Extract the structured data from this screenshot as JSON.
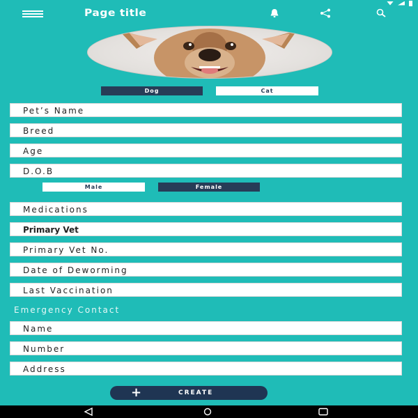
{
  "app_bar": {
    "title": "Page title"
  },
  "pet_type": {
    "options": [
      "Dog",
      "Cat"
    ],
    "selected": "Dog"
  },
  "fields_top": [
    {
      "placeholder": "Pet’s Name"
    },
    {
      "placeholder": "Breed"
    },
    {
      "placeholder": "Age"
    },
    {
      "placeholder": "D.O.B"
    }
  ],
  "gender": {
    "options": [
      "Male",
      "Female"
    ],
    "selected": "Female"
  },
  "fields_mid": [
    {
      "placeholder": "Medications"
    },
    {
      "placeholder": "Primary Vet"
    },
    {
      "placeholder": "Primary Vet No."
    },
    {
      "placeholder": "Date of Deworming"
    },
    {
      "placeholder": "Last Vaccination"
    }
  ],
  "emergency": {
    "section_label": "Emergency Contact",
    "fields": [
      {
        "placeholder": "Name"
      },
      {
        "placeholder": "Number"
      },
      {
        "placeholder": "Address"
      }
    ]
  },
  "create_button": {
    "icon": "+",
    "label": "CREATE"
  },
  "colors": {
    "background": "#1fbcb7",
    "primary_dark": "#273c57",
    "field_bg": "#ffffff"
  },
  "icons": [
    "menu-icon",
    "bell-icon",
    "share-icon",
    "search-icon",
    "back-icon",
    "home-icon",
    "recent-apps-icon"
  ]
}
